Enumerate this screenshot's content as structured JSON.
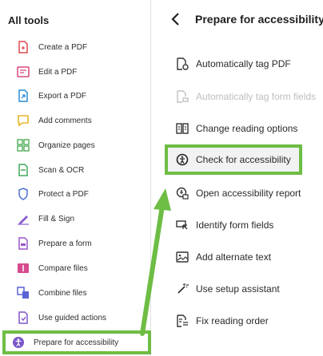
{
  "left_panel": {
    "title": "All tools",
    "items": [
      {
        "label": "Create a PDF",
        "icon": "create-pdf-icon",
        "color": "#e04a4a"
      },
      {
        "label": "Edit a PDF",
        "icon": "edit-pdf-icon",
        "color": "#d9477d"
      },
      {
        "label": "Export a PDF",
        "icon": "export-pdf-icon",
        "color": "#2a8ed6"
      },
      {
        "label": "Add comments",
        "icon": "comment-icon",
        "color": "#e8b82c"
      },
      {
        "label": "Organize pages",
        "icon": "organize-pages-icon",
        "color": "#4fae55"
      },
      {
        "label": "Scan & OCR",
        "icon": "scan-ocr-icon",
        "color": "#44a85a"
      },
      {
        "label": "Protect a PDF",
        "icon": "protect-pdf-icon",
        "color": "#4f6fd6"
      },
      {
        "label": "Fill & Sign",
        "icon": "fill-sign-icon",
        "color": "#8a5fd0"
      },
      {
        "label": "Prepare a form",
        "icon": "prepare-form-icon",
        "color": "#9b55c9"
      },
      {
        "label": "Compare files",
        "icon": "compare-files-icon",
        "color": "#d64a8e"
      },
      {
        "label": "Combine files",
        "icon": "combine-files-icon",
        "color": "#5a62d4"
      },
      {
        "label": "Use guided actions",
        "icon": "guided-actions-icon",
        "color": "#8155c9"
      },
      {
        "label": "Prepare for accessibility",
        "icon": "accessibility-icon",
        "color": "#7a55c9"
      }
    ]
  },
  "right_panel": {
    "back_icon": "chevron-left-icon",
    "title": "Prepare for accessibility",
    "items": [
      {
        "label": "Automatically tag PDF",
        "icon": "autotag-icon",
        "disabled": false
      },
      {
        "label": "Automatically tag form fields",
        "icon": "autotag-form-icon",
        "disabled": true
      },
      {
        "label": "Change reading options",
        "icon": "reading-options-icon",
        "disabled": false
      },
      {
        "label": "Check for accessibility",
        "icon": "check-accessibility-icon",
        "disabled": false
      },
      {
        "label": "Open accessibility report",
        "icon": "accessibility-report-icon",
        "disabled": false
      },
      {
        "label": "Identify form fields",
        "icon": "form-fields-icon",
        "disabled": false
      },
      {
        "label": "Add alternate text",
        "icon": "alt-text-icon",
        "disabled": false
      },
      {
        "label": "Use setup assistant",
        "icon": "setup-assistant-icon",
        "disabled": false
      },
      {
        "label": "Fix reading order",
        "icon": "reading-order-icon",
        "disabled": false
      }
    ]
  },
  "annotation": {
    "highlight_color": "#6ebd44"
  }
}
